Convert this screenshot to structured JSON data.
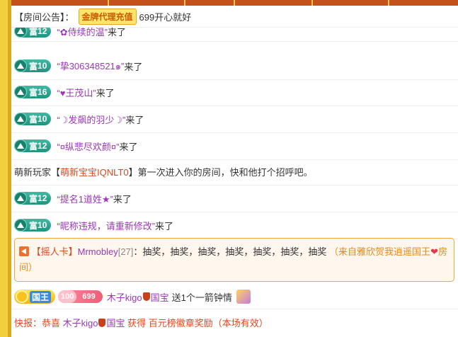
{
  "notice": {
    "label": "【房间公告】：",
    "badge": "金牌代理充值",
    "text": "699开心就好"
  },
  "level_prefix": "富",
  "entries": [
    {
      "level": "12",
      "name": "“✿侍续的温”",
      "suffix": "来了"
    },
    {
      "level": "10",
      "name": "“挚306348521๑”",
      "suffix": "来了"
    },
    {
      "level": "16",
      "name": "“♥王茂山”",
      "suffix": "来了"
    },
    {
      "level": "10",
      "name": "“☽发飙的羽少☽”",
      "suffix": "来了"
    },
    {
      "level": "12",
      "name": "“¤纵悲尽欢颜¤”",
      "suffix": "来了"
    }
  ],
  "system_msg": {
    "prefix": "萌新玩家【",
    "name": "萌新宝宝IQNLT0",
    "suffix": "】第一次进入你的房间，快和他打个招呼吧。"
  },
  "entries2": [
    {
      "level": "12",
      "name": "“提名1道姓★”",
      "suffix": "来了"
    },
    {
      "level": "10",
      "name": "“昵称违规，请重新修改”",
      "suffix": "来了"
    }
  ],
  "card": {
    "tag": "【摇人卡】",
    "user": "Mrmobley",
    "level": "[27]",
    "message": "：抽奖，抽奖，抽奖，抽奖，抽奖，抽奖，抽奖",
    "from": "（来自雅欣贺我逍遥国王",
    "heart": "❤",
    "room": "房间）"
  },
  "gift": {
    "king_label": "国王",
    "pill_level": "100",
    "pill_value": "699",
    "user": "木子kigo",
    "user_suffix": "国宝",
    "message": "送1个一箭钟情"
  },
  "flash": {
    "prefix": "快报：恭喜 ",
    "user": "木子kigo",
    "user_suffix": "国宝",
    "message": " 获得 百元榜徽章奖励（本场有效）"
  },
  "colors": {
    "accent": "#9a38b5",
    "level_badge": "#22927e",
    "frame": "#f2cf3c",
    "card_border": "#f5a63c"
  }
}
